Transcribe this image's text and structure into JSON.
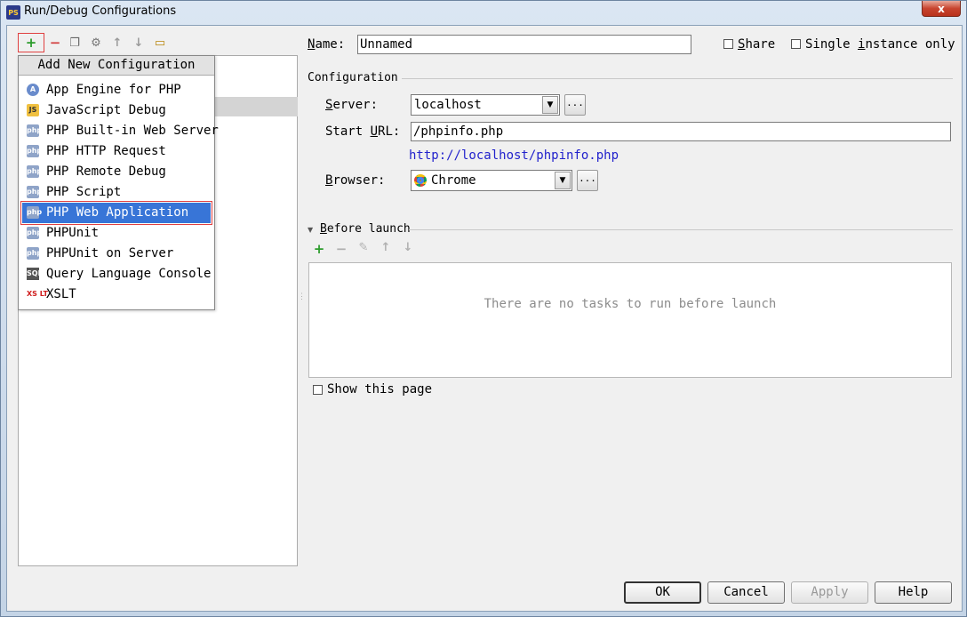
{
  "window": {
    "title": "Run/Debug Configurations",
    "icon": "phpstorm-icon",
    "close_label": "x"
  },
  "left_toolbar": {
    "add_label": "+",
    "remove_label": "−",
    "copy_icon": "copy-icon",
    "edit_defaults_icon": "wrench-icon",
    "move_up_icon": "arrow-up-icon",
    "move_down_icon": "arrow-down-icon",
    "folder_icon": "folder-icon",
    "copy_glyph": "❐",
    "wrench_glyph": "⚙",
    "up_glyph": "↑",
    "down_glyph": "↓",
    "folder_glyph": "▭"
  },
  "popup": {
    "title": "Add New Configuration",
    "items": [
      {
        "label": "App Engine for PHP",
        "icon": "app-engine-icon",
        "glyph": "A"
      },
      {
        "label": "JavaScript Debug",
        "icon": "javascript-debug-icon",
        "glyph": "JS"
      },
      {
        "label": "PHP Built-in Web Server",
        "icon": "php-icon",
        "glyph": "php"
      },
      {
        "label": "PHP HTTP Request",
        "icon": "php-http-icon",
        "glyph": "php"
      },
      {
        "label": "PHP Remote Debug",
        "icon": "php-remote-debug-icon",
        "glyph": "php"
      },
      {
        "label": "PHP Script",
        "icon": "php-script-icon",
        "glyph": "php"
      },
      {
        "label": "PHP Web Application",
        "icon": "php-web-app-icon",
        "glyph": "php",
        "selected": true
      },
      {
        "label": "PHPUnit",
        "icon": "phpunit-icon",
        "glyph": "php"
      },
      {
        "label": "PHPUnit on Server",
        "icon": "phpunit-server-icon",
        "glyph": "php"
      },
      {
        "label": "Query Language Console",
        "icon": "console-icon",
        "glyph": "SQL"
      },
      {
        "label": "XSLT",
        "icon": "xslt-icon",
        "glyph": "XS LT"
      }
    ]
  },
  "name": {
    "label_prefix": "N",
    "label_rest": "ame:",
    "value": "Unnamed"
  },
  "share": {
    "label_u": "S",
    "label_rest": "hare",
    "checked": false
  },
  "single_instance": {
    "label_pre": "Single ",
    "label_u": "i",
    "label_rest": "nstance only",
    "checked": false
  },
  "configuration": {
    "section_title": "Configuration",
    "server": {
      "label_u": "S",
      "label_rest": "erver:",
      "value": "localhost",
      "more": "..."
    },
    "start_url": {
      "label_pre": "Start ",
      "label_u": "U",
      "label_rest": "RL:",
      "value": "/phpinfo.php"
    },
    "resolved_url": "http://localhost/phpinfo.php",
    "browser": {
      "label_u": "B",
      "label_rest": "rowser:",
      "value": "Chrome",
      "icon": "chrome-icon",
      "more": "..."
    }
  },
  "before_launch": {
    "title_u": "B",
    "title_rest": "efore launch",
    "toolbar": {
      "add": "+",
      "remove": "−",
      "edit": "✎",
      "up": "↑",
      "down": "↓"
    },
    "empty_text": "There are no tasks to run before launch"
  },
  "show_page": {
    "label": "Show this page",
    "checked": false
  },
  "buttons": {
    "ok": "OK",
    "cancel": "Cancel",
    "apply": "Apply",
    "help": "Help"
  },
  "colors": {
    "selection": "#3875d7",
    "link": "#2222cc",
    "add_green": "#2c9c2c",
    "remove_red": "#d24040",
    "highlight_box": "#e04040"
  }
}
